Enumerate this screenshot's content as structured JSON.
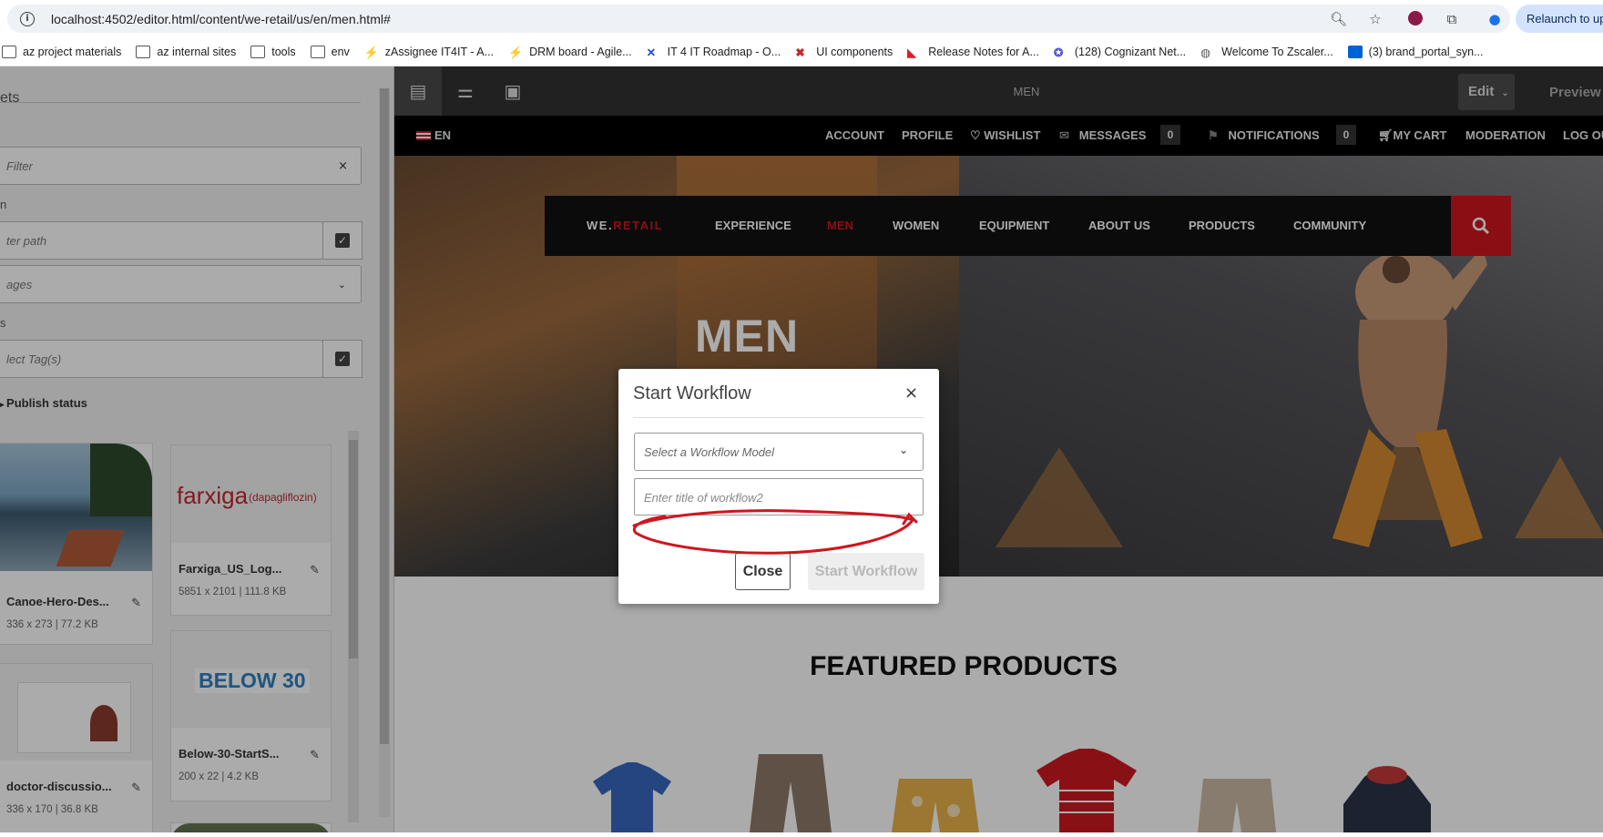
{
  "browser": {
    "url": "localhost:4502/editor.html/content/we-retail/us/en/men.html#",
    "relaunch_label": "Relaunch to upd",
    "bookmarks": [
      {
        "label": "az project materials",
        "icon": "folder-icon"
      },
      {
        "label": "az internal sites",
        "icon": "folder-icon"
      },
      {
        "label": "tools",
        "icon": "folder-icon"
      },
      {
        "label": "env",
        "icon": "folder-icon"
      },
      {
        "label": "zAssignee IT4IT - A...",
        "icon": "lightning-icon"
      },
      {
        "label": "DRM board - Agile...",
        "icon": "lightning-icon"
      },
      {
        "label": "IT 4 IT Roadmap - O...",
        "icon": "cross-icon"
      },
      {
        "label": "UI components",
        "icon": "ui-icon"
      },
      {
        "label": "Release Notes for A...",
        "icon": "adobe-icon"
      },
      {
        "label": "(128) Cognizant Net...",
        "icon": "teams-icon"
      },
      {
        "label": "Welcome To Zscaler...",
        "icon": "globe-icon"
      },
      {
        "label": "(3) brand_portal_syn...",
        "icon": "box-icon"
      }
    ]
  },
  "sidebar": {
    "title": "ets",
    "filter_placeholder": "Filter",
    "label_path": "n",
    "path_placeholder": "ter path",
    "pages_value": "ages",
    "label_tags": "s",
    "tags_placeholder": "lect Tag(s)",
    "publish_status": "Publish status",
    "assets": [
      {
        "name": "Canoe-Hero-Des...",
        "meta": "336 x 273 | 77.2 KB"
      },
      {
        "name": "Farxiga_US_Log...",
        "meta": "5851 x 2101 | 111.8 KB",
        "thumb_text": "farxiga",
        "thumb_sub": "(dapagliflozin)"
      },
      {
        "name": "doctor-discussio...",
        "meta": "336 x 170 | 36.8 KB"
      },
      {
        "name": "Below-30-StartS...",
        "meta": "200 x 22 | 4.2 KB",
        "thumb_text": "BELOW 30"
      }
    ]
  },
  "editor": {
    "page_title": "MEN",
    "edit_label": "Edit",
    "preview_label": "Preview"
  },
  "site": {
    "lang": "EN",
    "util": {
      "account": "ACCOUNT",
      "profile": "PROFILE",
      "wishlist": "WISHLIST",
      "messages": "MESSAGES",
      "messages_count": "0",
      "notifications": "NOTIFICATIONS",
      "notifications_count": "0",
      "cart": "MY CART",
      "moderation": "MODERATION",
      "logout": "LOG OU"
    },
    "logo_we": "WE.",
    "logo_retail": "RETAIL",
    "nav": [
      "EXPERIENCE",
      "MEN",
      "WOMEN",
      "EQUIPMENT",
      "ABOUT US",
      "PRODUCTS",
      "COMMUNITY"
    ],
    "hero_title": "MEN",
    "featured_title": "FEATURED PRODUCTS"
  },
  "modal": {
    "title": "Start Workflow",
    "select_placeholder": "Select a Workflow Model",
    "title_placeholder": "Enter title of workflow2",
    "close_label": "Close",
    "start_label": "Start Workflow"
  },
  "colors": {
    "accent_red": "#d0151e",
    "editor_dark": "#323232"
  }
}
